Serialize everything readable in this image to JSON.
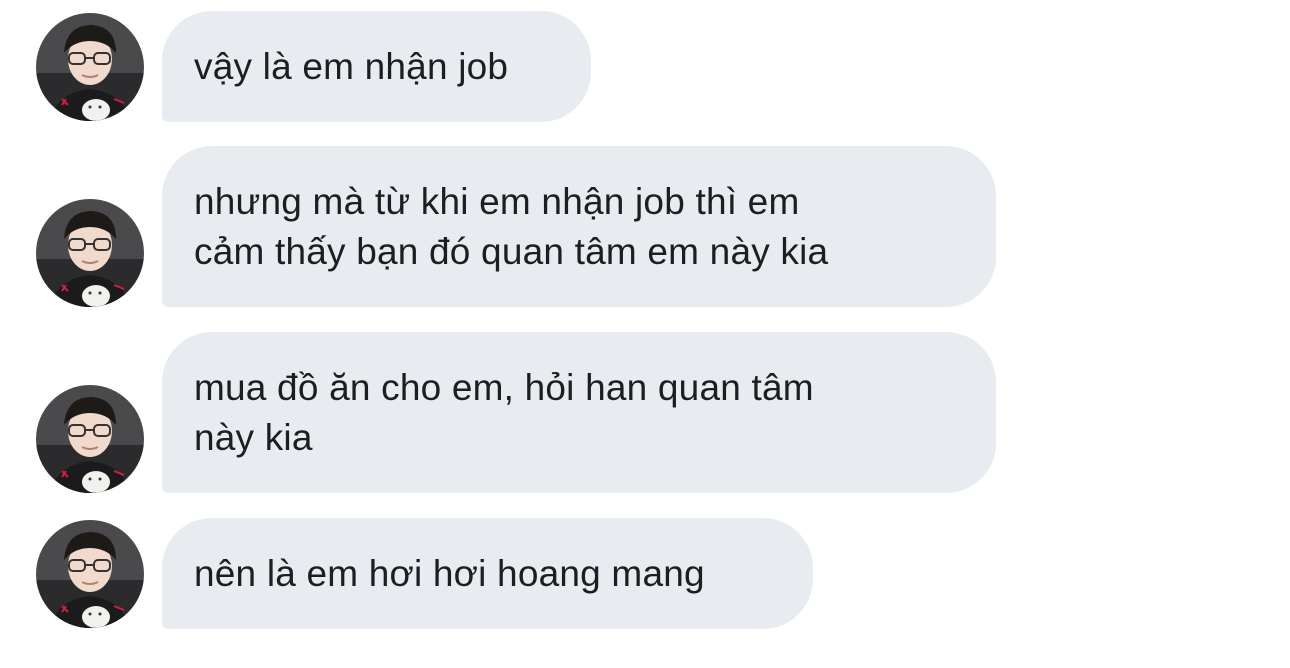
{
  "messages": [
    {
      "sender": "avatar",
      "lines": [
        "vậy là em nhận job"
      ]
    },
    {
      "sender": "avatar",
      "lines": [
        "nhưng mà từ khi em nhận job thì em",
        "cảm thấy bạn đó quan tâm em này kia"
      ]
    },
    {
      "sender": "avatar",
      "lines": [
        "mua đồ ăn cho em, hỏi han quan tâm",
        "này kia"
      ]
    },
    {
      "sender": "avatar",
      "lines": [
        "nên là em hơi hơi hoang mang"
      ]
    }
  ],
  "colors": {
    "bubble_bg": "#e8ebef",
    "text": "#1c1e21",
    "page_bg": "#ffffff"
  },
  "icons": {
    "avatar": "profile-photo-avatar"
  }
}
